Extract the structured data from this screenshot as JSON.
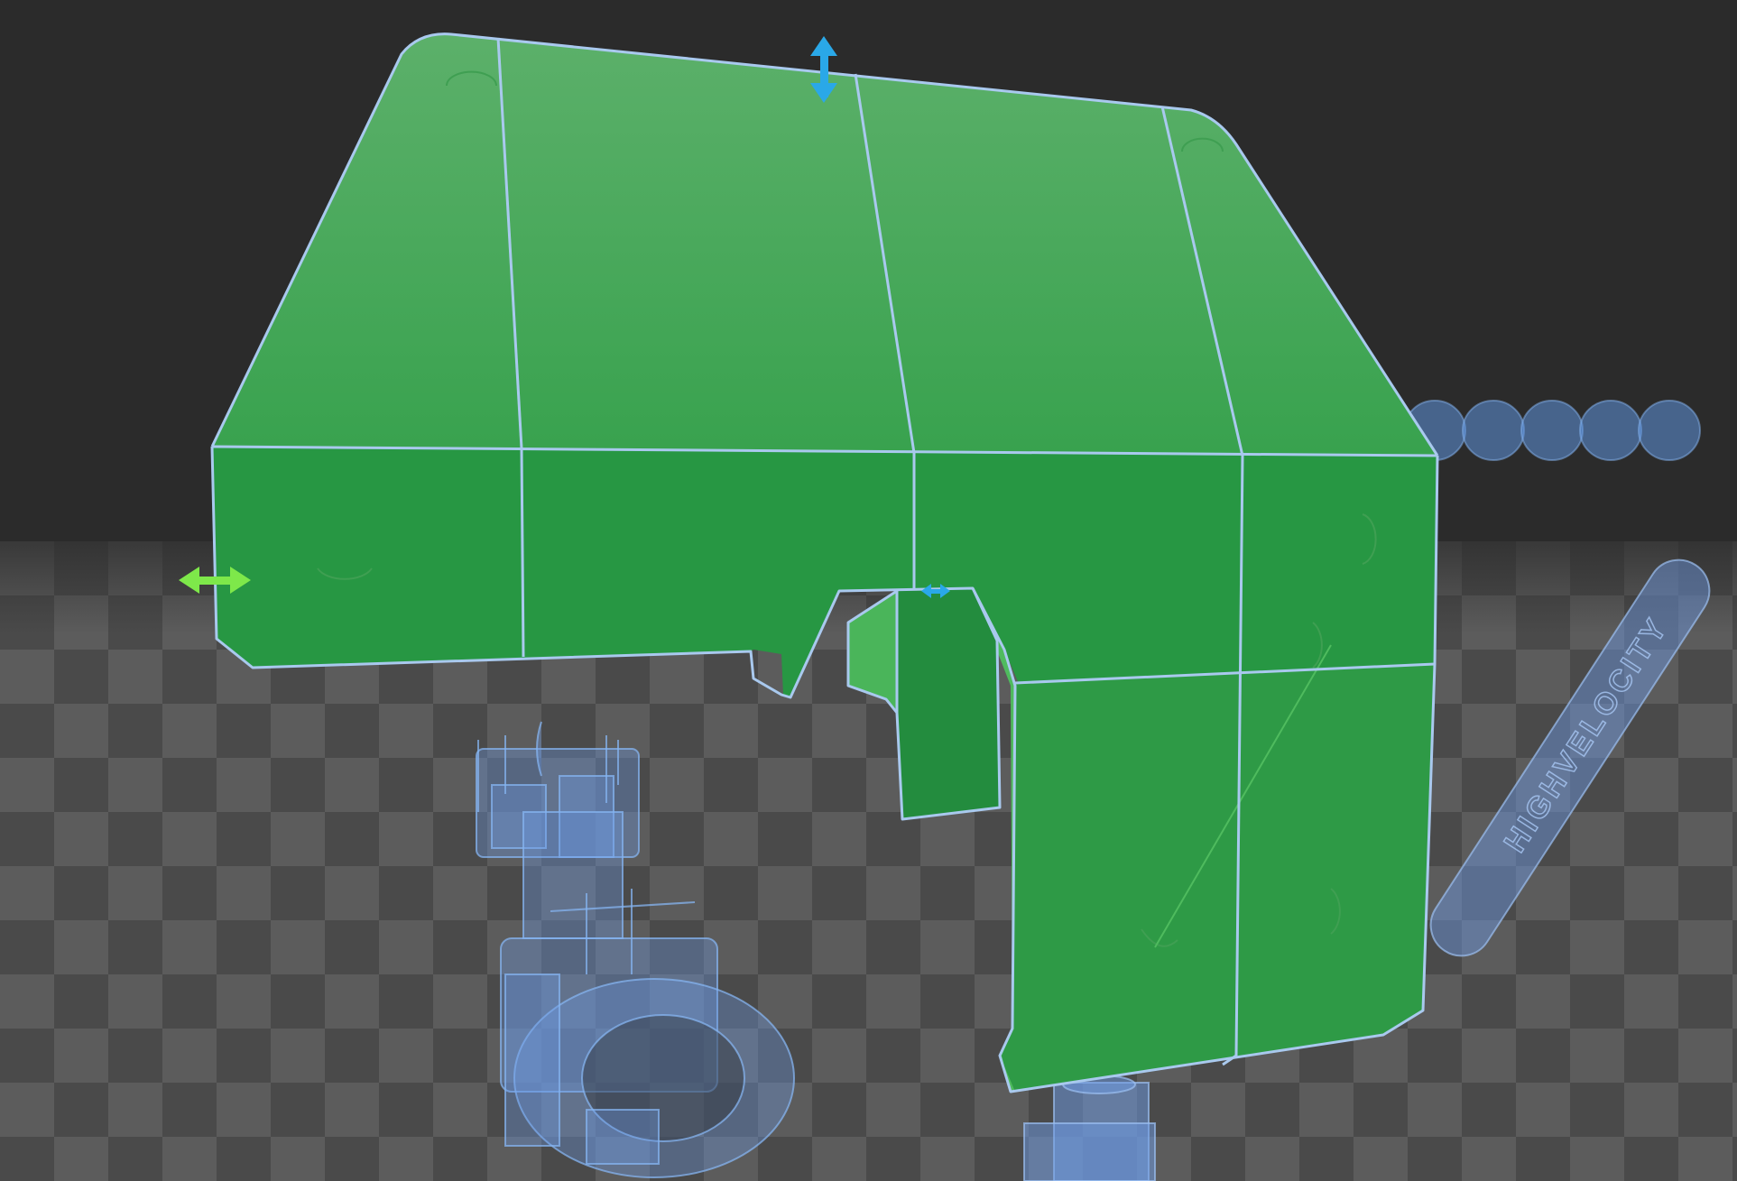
{
  "viewport": {
    "view_mode": "3d-perspective",
    "background_color": "#2b2b2b",
    "floor_colors": [
      "#4a4a4a",
      "#5c5c5c"
    ],
    "selected_part_color": "#2e9a46",
    "selection_outline_color": "#a9c9ee",
    "ghost_part_color": "#6e9be6"
  },
  "parts": {
    "selected": {
      "name": "green-cover",
      "state": "selected"
    },
    "ghost_parts": [
      {
        "name": "hinge-assembly",
        "state": "transparent"
      },
      {
        "name": "bead-chain",
        "state": "transparent"
      },
      {
        "name": "engraved-bar",
        "state": "transparent",
        "engraving": "HIGHVELOCITY"
      },
      {
        "name": "pedestal-block",
        "state": "transparent"
      }
    ]
  },
  "gizmos": {
    "vertical_arrow": {
      "icon": "double-arrow-vertical-icon",
      "color": "#2aa8e8",
      "axis": "vertical"
    },
    "horizontal_arrow": {
      "icon": "double-arrow-horizontal-icon",
      "color": "#7ee84a",
      "axis": "horizontal"
    },
    "small_arrow": {
      "icon": "double-arrow-small-icon",
      "color": "#2aa8e8",
      "axis": "depth"
    }
  }
}
